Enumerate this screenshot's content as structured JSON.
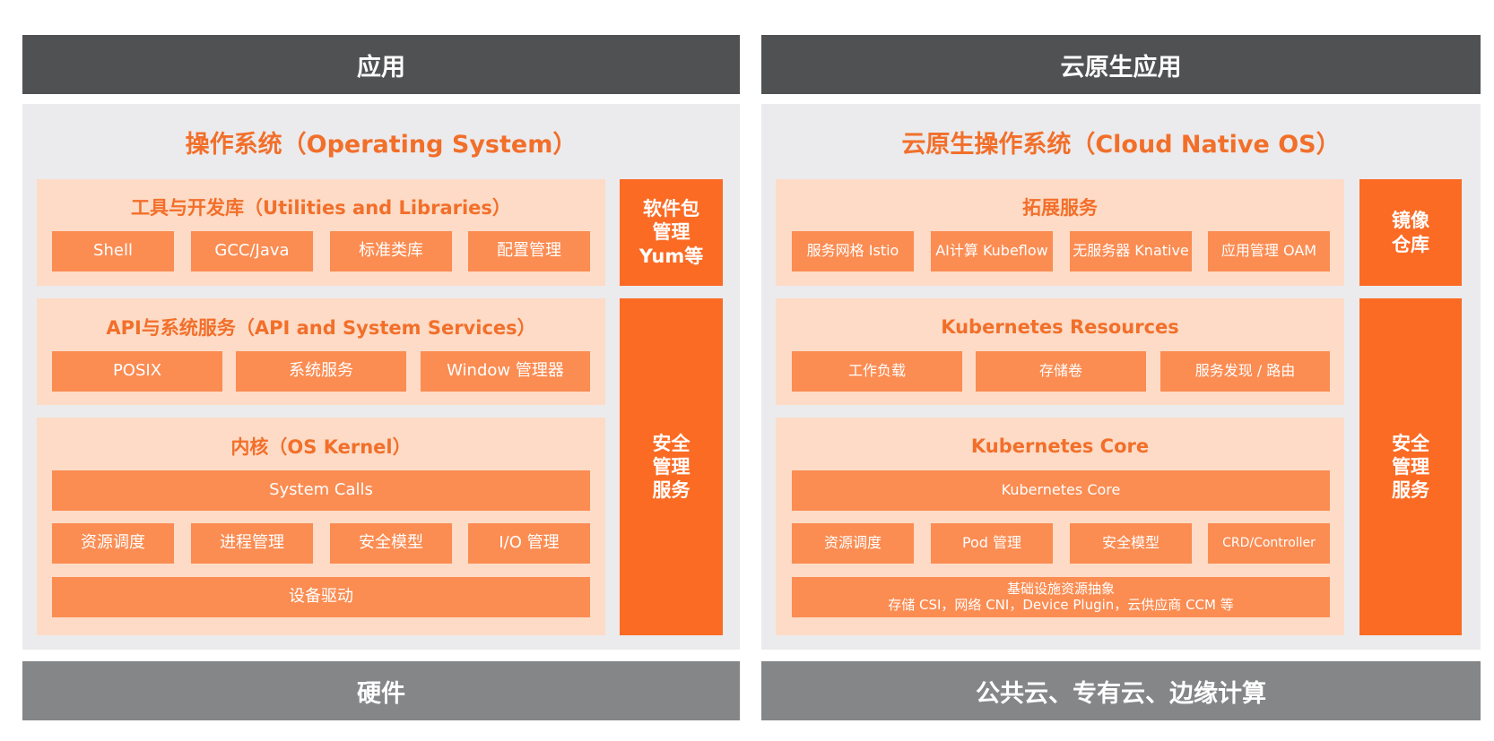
{
  "left": {
    "top_bar": "应用",
    "title": "操作系统（Operating System）",
    "layers": [
      {
        "title": "工具与开发库（Utilities and Libraries）",
        "items": [
          "Shell",
          "GCC/Java",
          "标准类库",
          "配置管理"
        ]
      },
      {
        "title": "API与系统服务（API and System Services）",
        "items": [
          "POSIX",
          "系统服务",
          "Window 管理器"
        ]
      },
      {
        "title": "内核（OS Kernel）",
        "full_row_1": "System Calls",
        "items": [
          "资源调度",
          "进程管理",
          "安全模型",
          "I/O 管理"
        ],
        "full_row_2": "设备驱动"
      }
    ],
    "side_boxes": [
      {
        "lines": [
          "软件包",
          "管理",
          "Yum等"
        ]
      },
      {
        "lines": [
          "安全",
          "管理",
          "服务"
        ]
      }
    ],
    "bottom_bar": "硬件"
  },
  "right": {
    "top_bar": "云原生应用",
    "title": "云原生操作系统（Cloud Native OS）",
    "layers": [
      {
        "title": "拓展服务",
        "items": [
          "服务网格 Istio",
          "AI计算 Kubeflow",
          "无服务器 Knative",
          "应用管理 OAM"
        ]
      },
      {
        "title": "Kubernetes Resources",
        "items": [
          "工作负载",
          "存储卷",
          "服务发现 / 路由"
        ]
      },
      {
        "title": "Kubernetes Core",
        "full_row_1": "Kubernetes Core",
        "items": [
          "资源调度",
          "Pod 管理",
          "安全模型",
          "CRD/Controller"
        ],
        "full_row_2_line1": "基础设施资源抽象",
        "full_row_2_line2": "存储 CSI，网络 CNI，Device Plugin，云供应商 CCM 等"
      }
    ],
    "side_boxes": [
      {
        "lines": [
          "镜像",
          "仓库"
        ]
      },
      {
        "lines": [
          "安全",
          "管理",
          "服务"
        ]
      }
    ],
    "bottom_bar": "公共云、专有云、边缘计算"
  },
  "colors": {
    "top_bar": "#505153",
    "bottom_bar": "#858688",
    "panel_bg": "#ebebed",
    "layer_bg": "#fddbc6",
    "cell": "#fb8c52",
    "side": "#fb6b24",
    "title_text": "#f26f2a"
  }
}
